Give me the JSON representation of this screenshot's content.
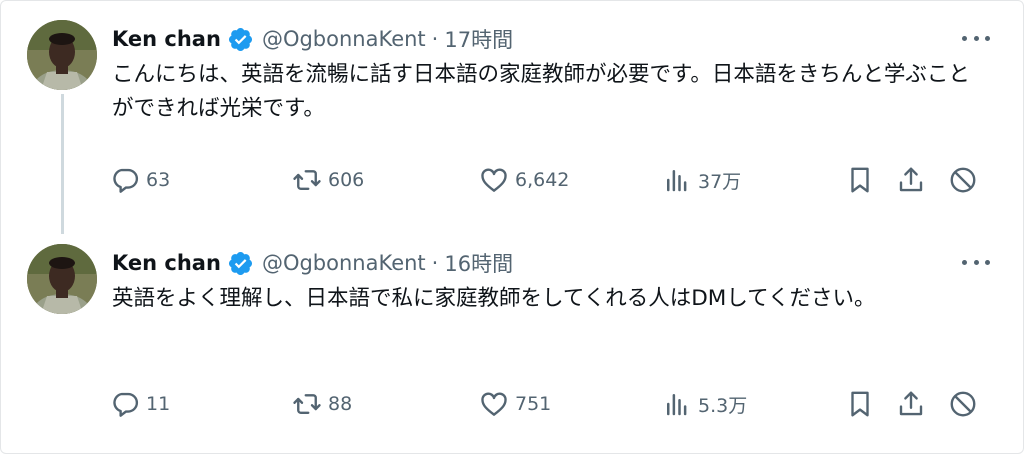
{
  "tweets": [
    {
      "author_name": "Ken chan",
      "handle": "@OgbonnaKent",
      "separator": "·",
      "time": "17時間",
      "text": "こんにちは、英語を流暢に話す日本語の家庭教師が必要です。日本語をきちんと学ぶことができれば光栄です。",
      "replies": "63",
      "retweets": "606",
      "likes": "6,642",
      "views": "37万"
    },
    {
      "author_name": "Ken chan",
      "handle": "@OgbonnaKent",
      "separator": "·",
      "time": "16時間",
      "text": "英語をよく理解し、日本語で私に家庭教師をしてくれる人はDMしてください。",
      "replies": "11",
      "retweets": "88",
      "likes": "751",
      "views": "5.3万"
    }
  ],
  "icons": {
    "verified": "verified-badge-icon",
    "more": "more-icon",
    "reply": "reply-icon",
    "retweet": "retweet-icon",
    "like": "heart-icon",
    "views": "views-icon",
    "bookmark": "bookmark-icon",
    "share": "share-icon",
    "block": "block-icon"
  },
  "colors": {
    "verified_blue": "#1d9bf0",
    "secondary_text": "#536471",
    "thread_line": "#cfd9de"
  }
}
